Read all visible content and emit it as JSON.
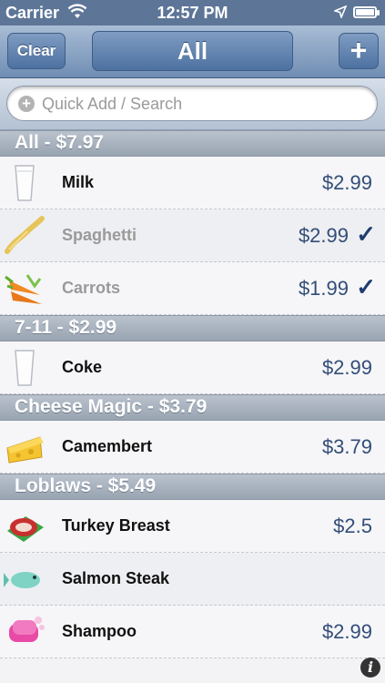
{
  "status_bar": {
    "carrier": "Carrier",
    "time": "12:57 PM"
  },
  "nav": {
    "clear_label": "Clear",
    "title": "All",
    "add_label": "+"
  },
  "search": {
    "placeholder": "Quick Add / Search",
    "value": ""
  },
  "sections": [
    {
      "header": "All - $7.97",
      "items": [
        {
          "name": "Milk",
          "price": "$2.99",
          "checked": false,
          "icon": "milk-glass-icon"
        },
        {
          "name": "Spaghetti",
          "price": "$2.99",
          "checked": true,
          "check": "✓",
          "icon": "spaghetti-icon"
        },
        {
          "name": "Carrots",
          "price": "$1.99",
          "checked": true,
          "check": "✓",
          "icon": "carrots-icon"
        }
      ]
    },
    {
      "header": "7-11 - $2.99",
      "items": [
        {
          "name": "Coke",
          "price": "$2.99",
          "checked": false,
          "icon": "glass-icon"
        }
      ]
    },
    {
      "header": "Cheese Magic - $3.79",
      "items": [
        {
          "name": "Camembert",
          "price": "$3.79",
          "checked": false,
          "icon": "cheese-icon"
        }
      ]
    },
    {
      "header": "Loblaws - $5.49",
      "items": [
        {
          "name": "Turkey Breast",
          "price": "$2.5",
          "checked": false,
          "icon": "meat-icon"
        },
        {
          "name": "Salmon Steak",
          "price": "",
          "checked": false,
          "icon": "fish-icon"
        },
        {
          "name": "Shampoo",
          "price": "$2.99",
          "checked": false,
          "icon": "soap-icon"
        }
      ]
    }
  ],
  "footer": {
    "info_label": "i"
  }
}
